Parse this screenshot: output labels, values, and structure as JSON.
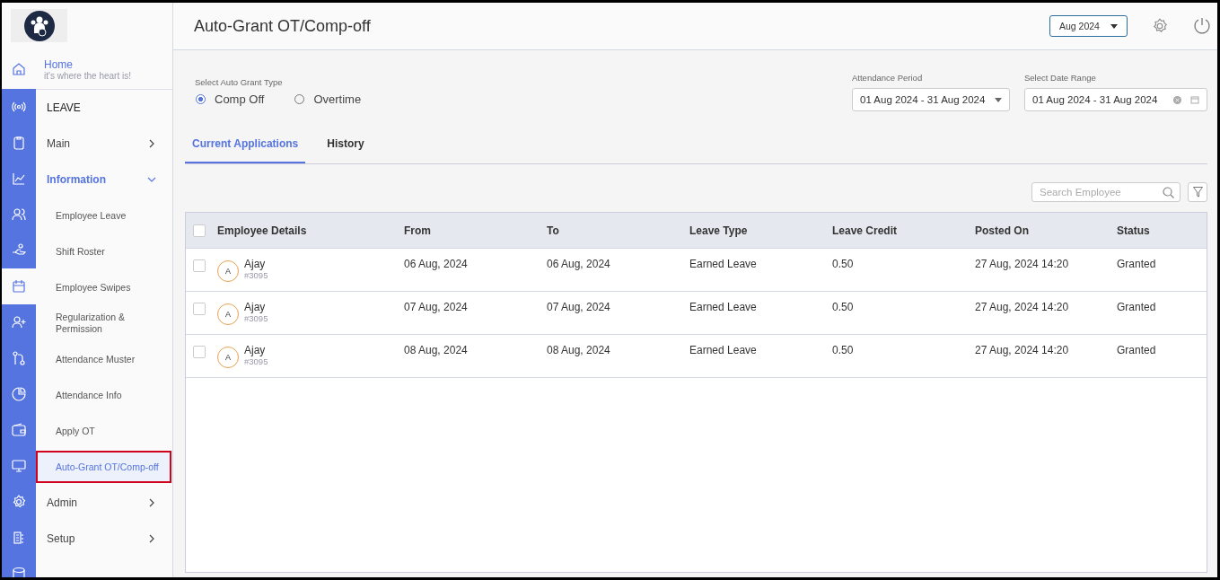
{
  "header": {
    "title": "Auto-Grant OT/Comp-off",
    "month": "Aug 2024"
  },
  "rail": [
    {
      "selected": true
    },
    {
      "selected": false
    },
    {
      "selected": false
    },
    {
      "selected": false
    },
    {
      "selected": false
    },
    {
      "selected": false
    },
    {
      "selected": true
    },
    {
      "selected": false
    },
    {
      "selected": false
    },
    {
      "selected": false
    },
    {
      "selected": false
    },
    {
      "selected": false
    },
    {
      "selected": false
    },
    {
      "selected": false
    },
    {
      "selected": false
    }
  ],
  "sidebar": {
    "home": {
      "label": "Home",
      "subtitle": "it's where the heart is!"
    },
    "section": "LEAVE",
    "items": [
      {
        "label": "Main",
        "expanded": false
      },
      {
        "label": "Information",
        "expanded": true,
        "children": [
          {
            "label": "Employee Leave",
            "selected": false
          },
          {
            "label": "Shift Roster",
            "selected": false
          },
          {
            "label": "Employee Swipes",
            "selected": false
          },
          {
            "label": "Regularization & Permission",
            "selected": false
          },
          {
            "label": "Attendance Muster",
            "selected": false
          },
          {
            "label": "Attendance Info",
            "selected": false
          },
          {
            "label": "Apply OT",
            "selected": false
          },
          {
            "label": "Auto-Grant OT/Comp-off",
            "selected": true
          }
        ]
      },
      {
        "label": "Admin",
        "expanded": false
      },
      {
        "label": "Setup",
        "expanded": false
      }
    ]
  },
  "grant_type": {
    "label": "Select Auto Grant Type",
    "options": [
      {
        "label": "Comp Off",
        "selected": true
      },
      {
        "label": "Overtime",
        "selected": false
      }
    ]
  },
  "attendance_period": {
    "label": "Attendance Period",
    "value": "01 Aug 2024 - 31 Aug 2024"
  },
  "date_range": {
    "label": "Select Date Range",
    "value": "01 Aug 2024 - 31 Aug 2024"
  },
  "tabs": [
    {
      "label": "Current Applications",
      "selected": true
    },
    {
      "label": "History",
      "selected": false
    }
  ],
  "search": {
    "placeholder": "Search Employee"
  },
  "table": {
    "select_all_checked": false,
    "columns": [
      "Employee Details",
      "From",
      "To",
      "Leave Type",
      "Leave Credit",
      "Posted On",
      "Status"
    ],
    "rows": [
      {
        "checked": false,
        "initial": "A",
        "name": "Ajay",
        "id": "#3095",
        "from": "06 Aug, 2024",
        "to": "06 Aug, 2024",
        "leave_type": "Earned Leave",
        "credit": "0.50",
        "posted_on": "27 Aug, 2024 14:20",
        "status": "Granted"
      },
      {
        "checked": false,
        "initial": "A",
        "name": "Ajay",
        "id": "#3095",
        "from": "07 Aug, 2024",
        "to": "07 Aug, 2024",
        "leave_type": "Earned Leave",
        "credit": "0.50",
        "posted_on": "27 Aug, 2024 14:20",
        "status": "Granted"
      },
      {
        "checked": false,
        "initial": "A",
        "name": "Ajay",
        "id": "#3095",
        "from": "08 Aug, 2024",
        "to": "08 Aug, 2024",
        "leave_type": "Earned Leave",
        "credit": "0.50",
        "posted_on": "27 Aug, 2024 14:20",
        "status": "Granted"
      }
    ]
  }
}
